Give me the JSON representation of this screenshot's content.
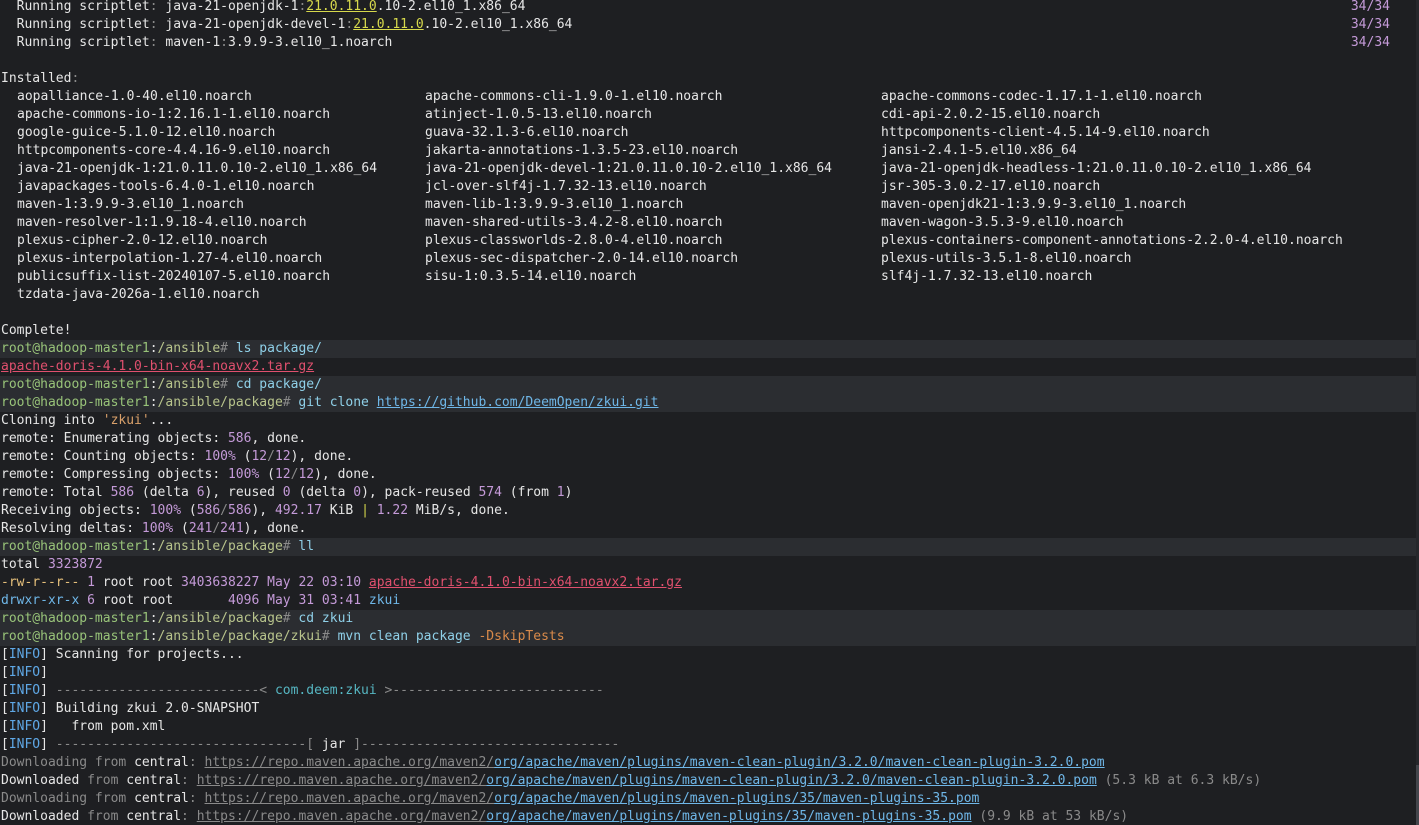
{
  "terminal": {
    "scriptlets": [
      {
        "prefix": "  Running scriptlet",
        "sep": ":",
        "pkg_a": " java-21-openjdk-1",
        "colon": ":",
        "ver": "21.0.11.0",
        "pkg_b": ".10-2.el10_1.x86_64",
        "progress": "34/34"
      },
      {
        "prefix": "  Running scriptlet",
        "sep": ":",
        "pkg_a": " java-21-openjdk-devel-1",
        "colon": ":",
        "ver": "21.0.11.0",
        "pkg_b": ".10-2.el10_1.x86_64",
        "progress": "34/34"
      },
      {
        "prefix": "  Running scriptlet",
        "sep": ":",
        "pkg_a": " maven-1",
        "colon": ":",
        "ver": "",
        "pkg_b": "3.9.9-3.el10_1.noarch",
        "progress": "34/34"
      }
    ],
    "installed_header": "Installed",
    "installed_colon": ":",
    "installed_rows": [
      [
        "aopalliance-1.0-40.el10.noarch",
        "apache-commons-cli-1.9.0-1.el10.noarch",
        "apache-commons-codec-1.17.1-1.el10.noarch"
      ],
      [
        "apache-commons-io-1:2.16.1-1.el10.noarch",
        "atinject-1.0.5-13.el10.noarch",
        "cdi-api-2.0.2-15.el10.noarch"
      ],
      [
        "google-guice-5.1.0-12.el10.noarch",
        "guava-32.1.3-6.el10.noarch",
        "httpcomponents-client-4.5.14-9.el10.noarch"
      ],
      [
        "httpcomponents-core-4.4.16-9.el10.noarch",
        "jakarta-annotations-1.3.5-23.el10.noarch",
        "jansi-2.4.1-5.el10.x86_64"
      ],
      [
        "java-21-openjdk-1:21.0.11.0.10-2.el10_1.x86_64",
        "java-21-openjdk-devel-1:21.0.11.0.10-2.el10_1.x86_64",
        "java-21-openjdk-headless-1:21.0.11.0.10-2.el10_1.x86_64"
      ],
      [
        "javapackages-tools-6.4.0-1.el10.noarch",
        "jcl-over-slf4j-1.7.32-13.el10.noarch",
        "jsr-305-3.0.2-17.el10.noarch"
      ],
      [
        "maven-1:3.9.9-3.el10_1.noarch",
        "maven-lib-1:3.9.9-3.el10_1.noarch",
        "maven-openjdk21-1:3.9.9-3.el10_1.noarch"
      ],
      [
        "maven-resolver-1:1.9.18-4.el10.noarch",
        "maven-shared-utils-3.4.2-8.el10.noarch",
        "maven-wagon-3.5.3-9.el10.noarch"
      ],
      [
        "plexus-cipher-2.0-12.el10.noarch",
        "plexus-classworlds-2.8.0-4.el10.noarch",
        "plexus-containers-component-annotations-2.2.0-4.el10.noarch"
      ],
      [
        "plexus-interpolation-1.27-4.el10.noarch",
        "plexus-sec-dispatcher-2.0-14.el10.noarch",
        "plexus-utils-3.5.1-8.el10.noarch"
      ],
      [
        "publicsuffix-list-20240107-5.el10.noarch",
        "sisu-1:0.3.5-14.el10.noarch",
        "slf4j-1.7.32-13.el10.noarch"
      ],
      [
        "tzdata-java-2026a-1.el10.noarch",
        "",
        ""
      ]
    ],
    "complete": "Complete!",
    "prompt": {
      "user_host": "root@hadoop-master1",
      "colon": ":",
      "hash": "#"
    },
    "cmd_ls": {
      "path": "/ansible",
      "cmd": " ls package/"
    },
    "ls_output": "apache-doris-4.1.0-bin-x64-noavx2.tar.gz",
    "cmd_cd": {
      "path": "/ansible",
      "cmd": " cd package/"
    },
    "cmd_git": {
      "path": "/ansible/package",
      "cmd": " git clone ",
      "url": "https://github.com/DeemOpen/zkui.git"
    },
    "git_lines": {
      "cloning_a": "Cloning into ",
      "cloning_b": "'zkui'",
      "cloning_c": "...",
      "enum_a": "remote: Enumerating objects: ",
      "enum_n": "586",
      "enum_b": ", done.",
      "count_a": "remote: Counting objects: ",
      "count_p": "100%",
      "count_b": " (",
      "count_n1": "12",
      "count_s": "/",
      "count_n2": "12",
      "count_c": "), done.",
      "comp_a": "remote: Compressing objects: ",
      "comp_p": "100%",
      "comp_b": " (",
      "comp_n1": "12",
      "comp_s": "/",
      "comp_n2": "12",
      "comp_c": "), done.",
      "total_a": "remote: Total ",
      "total_n1": "586",
      "total_b": " (delta ",
      "total_n2": "6",
      "total_c": "), reused ",
      "total_n3": "0",
      "total_d": " (delta ",
      "total_n4": "0",
      "total_e": "), pack-reused ",
      "total_n5": "574",
      "total_f": " (from ",
      "total_n6": "1",
      "total_g": ")",
      "recv_a": "Receiving objects: ",
      "recv_p": "100%",
      "recv_b": " (",
      "recv_n1": "586",
      "recv_s": "/",
      "recv_n2": "586",
      "recv_c": "), ",
      "recv_n3": "492.17",
      "recv_d": " KiB ",
      "recv_pipe": "|",
      "recv_n4": " 1.22",
      "recv_e": " MiB/s, done.",
      "delta_a": "Resolving deltas: ",
      "delta_p": "100%",
      "delta_b": " (",
      "delta_n1": "241",
      "delta_s": "/",
      "delta_n2": "241",
      "delta_c": "), done."
    },
    "cmd_ll": {
      "path": "/ansible/package",
      "cmd": " ll"
    },
    "ll_total_a": "total ",
    "ll_total_n": "3323872",
    "ll_rows": [
      {
        "perm": "-rw-r--r--",
        "links": " 1",
        "owner": " root root ",
        "size": "3403638227",
        "date": " May 22 03:10 ",
        "name": "apache-doris-4.1.0-bin-x64-noavx2.tar.gz"
      },
      {
        "perm": "drwxr-xr-x",
        "links": " 6",
        "owner": " root root       ",
        "size": "4096",
        "date": " May 31 03:41 ",
        "name": "zkui"
      }
    ],
    "cmd_cd2": {
      "path": "/ansible/package",
      "cmd": " cd zkui"
    },
    "cmd_mvn": {
      "path": "/ansible/package/zkui",
      "cmd": " mvn clean package ",
      "flag": "-DskipTests"
    },
    "mvn_lines": {
      "tag": "INFO",
      "scan": " Scanning for projects...",
      "dash_a": " --------------------------< ",
      "artifact": "com.deem:zkui",
      "dash_b": " >---------------------------",
      "building": " Building zkui 2.0-SNAPSHOT",
      "from_pom": "   from pom.xml",
      "jar_a": " --------------------------------[ ",
      "jar": "jar",
      "jar_b": " ]---------------------------------"
    },
    "downloads": [
      {
        "verb": "Downloading",
        "from": " from ",
        "repo": "central",
        "colon": ": ",
        "base": "https://repo.maven.apache.org/maven2/",
        "path": "org/apache/maven/plugins/maven-clean-plugin/3.2.0/maven-clean-plugin-3.2.0.pom",
        "stat": ""
      },
      {
        "verb": "Downloaded",
        "from": " from ",
        "repo": "central",
        "colon": ": ",
        "base": "https://repo.maven.apache.org/maven2/",
        "path": "org/apache/maven/plugins/maven-clean-plugin/3.2.0/maven-clean-plugin-3.2.0.pom",
        "stat": " (5.3 kB at 6.3 kB/s)"
      },
      {
        "verb": "Downloading",
        "from": " from ",
        "repo": "central",
        "colon": ": ",
        "base": "https://repo.maven.apache.org/maven2/",
        "path": "org/apache/maven/plugins/maven-plugins/35/maven-plugins-35.pom",
        "stat": ""
      },
      {
        "verb": "Downloaded",
        "from": " from ",
        "repo": "central",
        "colon": ": ",
        "base": "https://repo.maven.apache.org/maven2/",
        "path": "org/apache/maven/plugins/maven-plugins/35/maven-plugins-35.pom",
        "stat": " (9.9 kB at 53 kB/s)"
      }
    ]
  }
}
